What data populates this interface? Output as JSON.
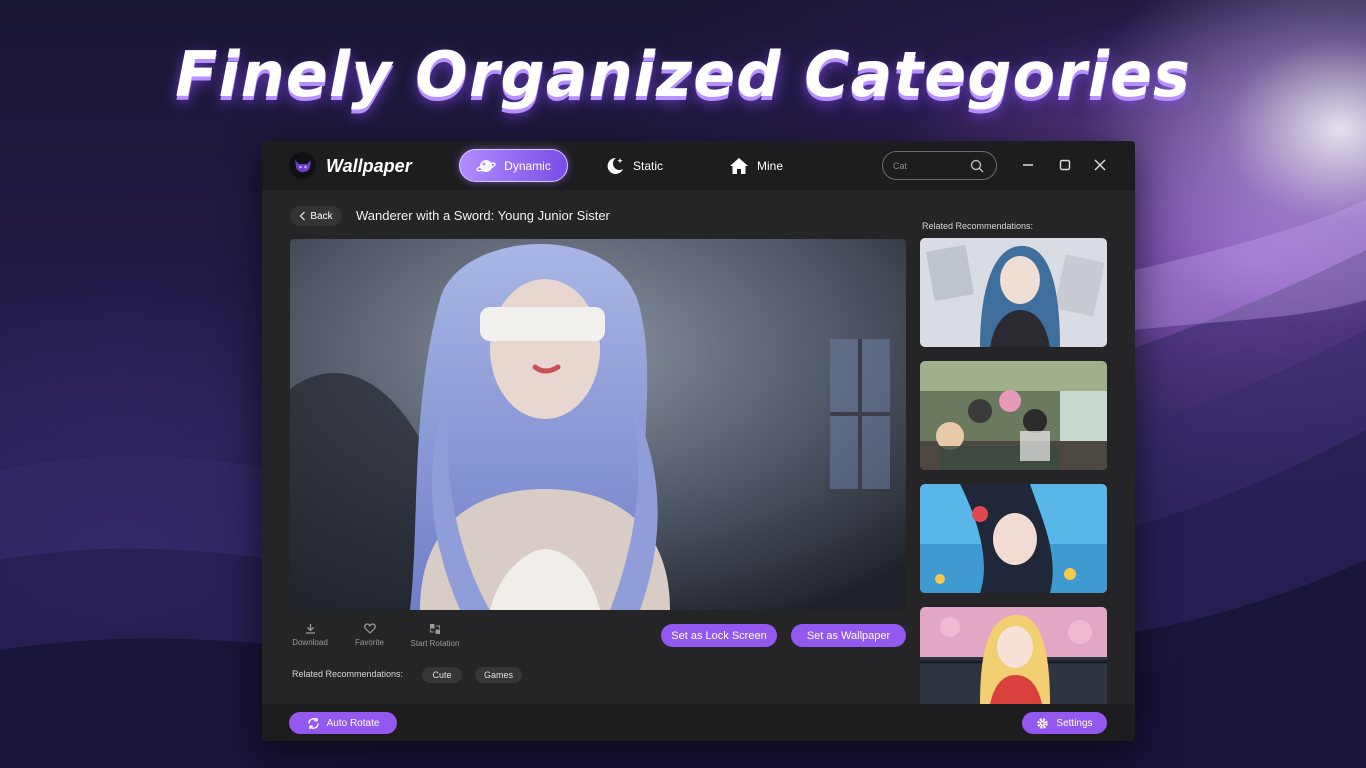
{
  "promo": {
    "headline": "Finely Organized Categories"
  },
  "app": {
    "name": "Wallpaper"
  },
  "nav": {
    "tabs": [
      {
        "label": "Dynamic",
        "active": true,
        "icon": "planet-icon"
      },
      {
        "label": "Static",
        "active": false,
        "icon": "moon-star-icon"
      },
      {
        "label": "Mine",
        "active": false,
        "icon": "home-icon"
      }
    ]
  },
  "search": {
    "placeholder": "Cat"
  },
  "window_controls": [
    "minimize-icon",
    "maximize-icon",
    "close-icon"
  ],
  "detail": {
    "back_label": "Back",
    "title": "Wanderer with a Sword: Young Junior Sister",
    "actions": [
      {
        "label": "Download",
        "icon": "download-icon"
      },
      {
        "label": "Favorite",
        "icon": "heart-icon"
      },
      {
        "label": "Start Rotation",
        "icon": "rotation-icon"
      }
    ],
    "lock_screen_label": "Set as Lock Screen",
    "wallpaper_label": "Set as Wallpaper",
    "related_label": "Related Recommendations:",
    "tags": [
      "Cute",
      "Games"
    ]
  },
  "sidebar": {
    "title": "Related Recommendations:",
    "thumbnails": 4
  },
  "footer": {
    "auto_rotate_label": "Auto Rotate",
    "settings_label": "Settings"
  },
  "colors": {
    "accent": "#9358f0",
    "window_bg": "#252527",
    "titlebar_bg": "#1d1d1f"
  }
}
